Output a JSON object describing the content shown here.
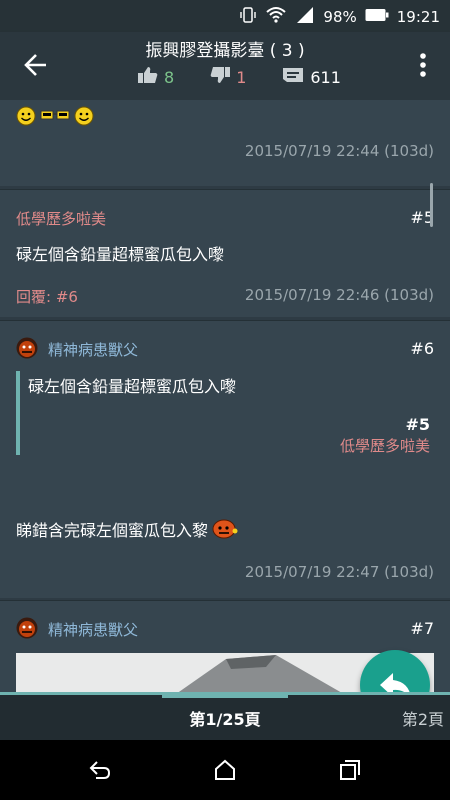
{
  "status_bar": {
    "battery": "98%",
    "time": "19:21"
  },
  "header": {
    "title": "振興膠登攝影臺 ( 3 )",
    "likes": "8",
    "dislikes": "1",
    "replies_count": "611"
  },
  "posts": [
    {
      "emoticons": "smiley-icons",
      "timestamp": "2015/07/19 22:44 (103d)"
    },
    {
      "username": "低學歷多啦美",
      "number": "#5",
      "body": "碌左個含鉛量超標蜜瓜包入嚟",
      "reply_ref": "回覆: #6",
      "timestamp": "2015/07/19 22:46 (103d)"
    },
    {
      "username": "精神病患獸父",
      "number": "#6",
      "quote_body": "碌左個含鉛量超標蜜瓜包入嚟",
      "quote_number": "#5",
      "quote_user": "低學歷多啦美",
      "body": "睇錯含完碌左個蜜瓜包入黎",
      "timestamp": "2015/07/19 22:47 (103d)"
    },
    {
      "username": "精神病患獸父",
      "number": "#7"
    }
  ],
  "pager": {
    "current": "第1/25頁",
    "next": "第2頁"
  },
  "colors": {
    "accent": "#6fb3b0",
    "fab": "#1aa08d",
    "like": "#7cc38a",
    "dislike": "#e08a8a",
    "username_pink": "#e08a8a",
    "username_blue": "#8fb8d8"
  }
}
